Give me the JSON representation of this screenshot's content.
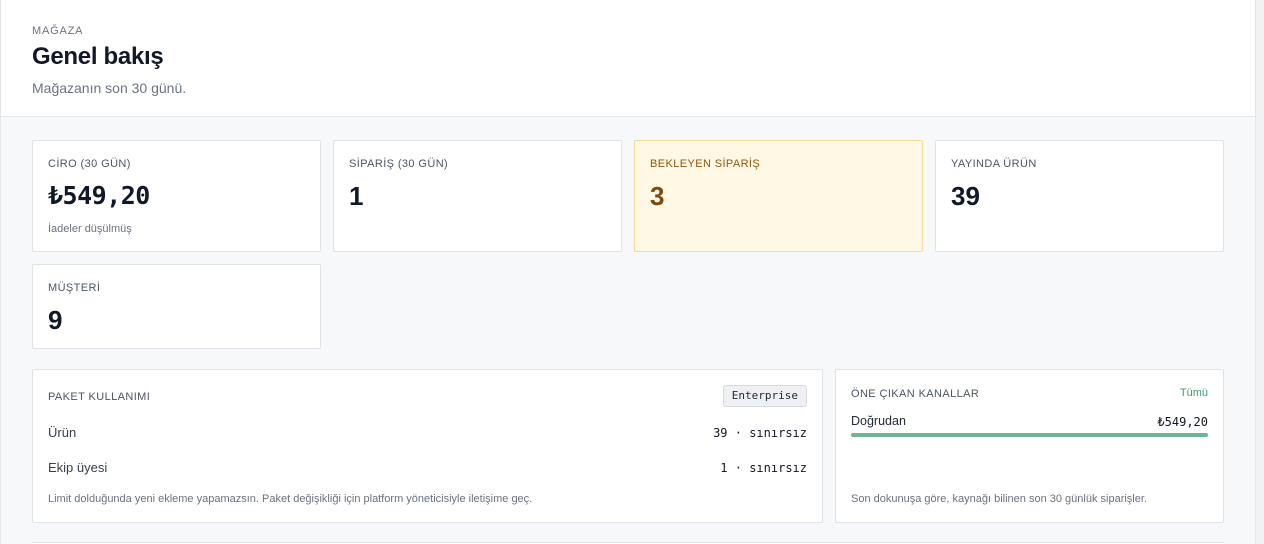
{
  "header": {
    "eyebrow": "MAĞAZA",
    "title": "Genel bakış",
    "subtitle": "Mağazanın son 30 günü."
  },
  "stats": [
    {
      "label": "CİRO (30 GÜN)",
      "value": "₺549,20",
      "note": "İadeler düşülmüş"
    },
    {
      "label": "SİPARİŞ (30 GÜN)",
      "value": "1"
    },
    {
      "label": "BEKLEYEN SİPARİŞ",
      "value": "3"
    },
    {
      "label": "YAYINDA ÜRÜN",
      "value": "39"
    },
    {
      "label": "MÜŞTERİ",
      "value": "9"
    }
  ],
  "plan_usage": {
    "title": "PAKET KULLANIMI",
    "plan_badge": "Enterprise",
    "rows": [
      {
        "name": "Ürün",
        "value": "39 · sınırsız"
      },
      {
        "name": "Ekip üyesi",
        "value": "1 · sınırsız"
      }
    ],
    "note": "Limit dolduğunda yeni ekleme yapamazsın. Paket değişikliği için platform yöneticisiyle iletişime geç."
  },
  "channels": {
    "title": "ÖNE ÇIKAN KANALLAR",
    "view_all": "Tümü",
    "items": [
      {
        "name": "Doğrudan",
        "value": "₺549,20",
        "share": 1.0
      }
    ],
    "note": "Son dokunuşa göre, kaynağı bilinen son 30 günlük siparişler."
  },
  "colors": {
    "accent": "#3f9b70",
    "bar": "#6db594",
    "warn_bg": "#fef8e4",
    "warn_text": "#7a4a12"
  }
}
